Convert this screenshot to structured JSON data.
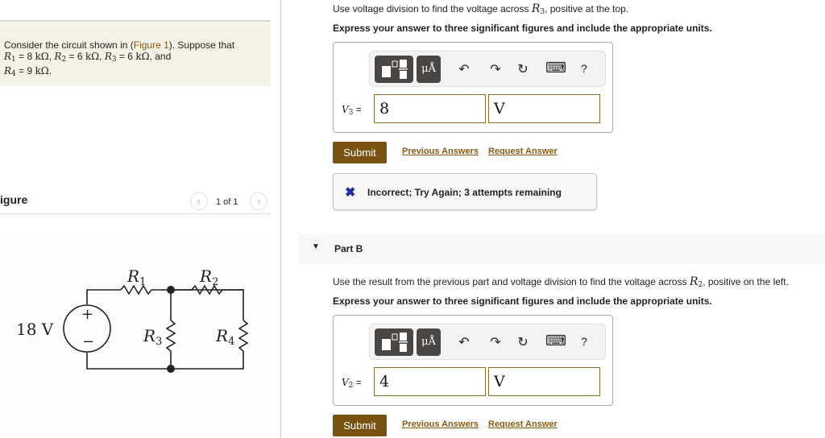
{
  "problem": {
    "intro_before_link": "Consider the circuit shown in (",
    "figure_link": "Figure 1",
    "intro_after_link": "). Suppose that",
    "values": [
      {
        "name": "R",
        "sub": "1",
        "value": "8",
        "unit": "kΩ"
      },
      {
        "name": "R",
        "sub": "2",
        "value": "6",
        "unit": "kΩ"
      },
      {
        "name": "R",
        "sub": "3",
        "value": "6",
        "unit": "kΩ"
      },
      {
        "name": "R",
        "sub": "4",
        "value": "9",
        "unit": "kΩ"
      }
    ],
    "and_word": ", and",
    "period": "."
  },
  "figure": {
    "title": "igure",
    "pager_text": "1 of 1",
    "prev_icon": "‹",
    "next_icon": "›",
    "circuit": {
      "source_label": "18 V",
      "plus": "+",
      "minus": "−",
      "r1": "R",
      "r1_sub": "1",
      "r2": "R",
      "r2_sub": "2",
      "r3": "R",
      "r3_sub": "3",
      "r4": "R",
      "r4_sub": "4"
    }
  },
  "part_a": {
    "instruction_before": "Use voltage division to find the voltage across ",
    "instruction_var": "R",
    "instruction_sub": "3",
    "instruction_after": ", positive at the top.",
    "express": "Express your answer to three significant figures and include the appropriate units.",
    "toolbar": {
      "templates_icon": "templates-icon",
      "units_label": "μÅ",
      "undo": "↶",
      "redo": "↷",
      "reset": "↻",
      "keyboard": "⌨",
      "help": "?"
    },
    "var_name": "V",
    "var_sub": "3",
    "equals": " =",
    "value": "8",
    "units": "V",
    "submit": "Submit",
    "previous_answers": "Previous Answers",
    "request_answer": "Request Answer",
    "feedback_icon": "✖",
    "feedback": "Incorrect; Try Again; 3 attempts remaining"
  },
  "part_b": {
    "title": "Part B",
    "caret": "▼",
    "instruction_before": "Use the result from the previous part and voltage division to find the voltage across ",
    "instruction_var": "R",
    "instruction_sub": "2",
    "instruction_after": ", positive on the left.",
    "express": "Express your answer to three significant figures and include the appropriate units.",
    "toolbar": {
      "units_label": "μÅ",
      "undo": "↶",
      "redo": "↷",
      "reset": "↻",
      "keyboard": "⌨",
      "help": "?"
    },
    "var_name": "V",
    "var_sub": "2",
    "equals": " =",
    "value": "4",
    "units": "V",
    "submit": "Submit",
    "previous_answers": "Previous Answers",
    "request_answer": "Request Answer"
  },
  "colors": {
    "accent": "#7a520f",
    "link": "#8a5a12",
    "problem_bg": "#f5f3e6",
    "feedback_icon": "#1d2bb0"
  }
}
